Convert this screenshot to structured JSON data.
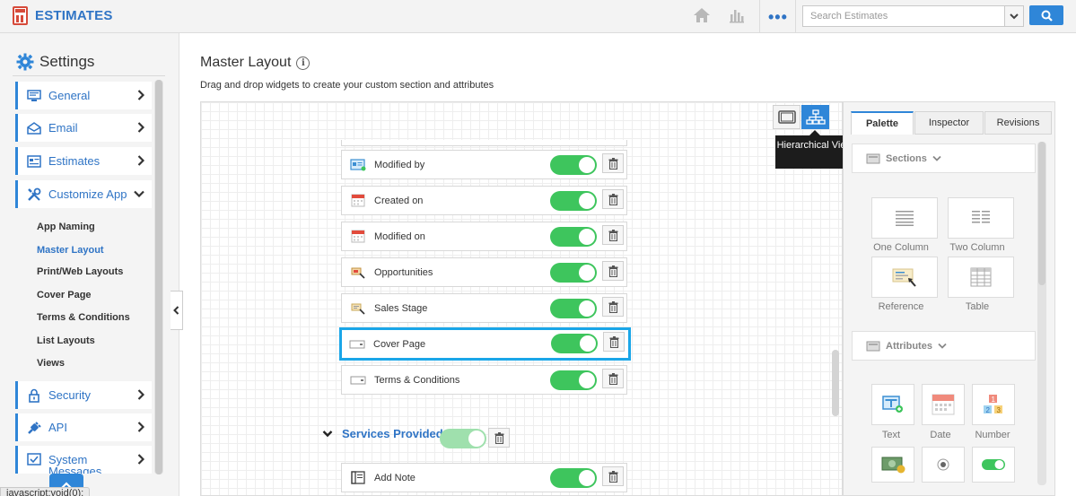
{
  "app": {
    "name": "ESTIMATES"
  },
  "search": {
    "placeholder": "Search Estimates"
  },
  "sidebar": {
    "title": "Settings",
    "items": [
      {
        "label": "General"
      },
      {
        "label": "Email"
      },
      {
        "label": "Estimates"
      },
      {
        "label": "Customize App"
      },
      {
        "label": "Security"
      },
      {
        "label": "API"
      },
      {
        "label": "System Messages"
      }
    ],
    "subitems": [
      {
        "label": "App Naming"
      },
      {
        "label": "Master Layout"
      },
      {
        "label": "Print/Web Layouts"
      },
      {
        "label": "Cover Page"
      },
      {
        "label": "Terms & Conditions"
      },
      {
        "label": "List Layouts"
      },
      {
        "label": "Views"
      }
    ]
  },
  "status_tip": "javascript:void(0);",
  "main": {
    "title": "Master Layout",
    "description": "Drag and drop widgets to create your custom section and attributes",
    "tooltip": "Hierarchical View",
    "rows": [
      {
        "label": "Modified by",
        "icon": "user-card-icon"
      },
      {
        "label": "Created on",
        "icon": "calendar-icon"
      },
      {
        "label": "Modified on",
        "icon": "calendar-icon"
      },
      {
        "label": "Opportunities",
        "icon": "opportunity-icon"
      },
      {
        "label": "Sales Stage",
        "icon": "reference-icon"
      },
      {
        "label": "Cover Page",
        "icon": "text-field-icon"
      },
      {
        "label": "Terms & Conditions",
        "icon": "text-field-icon"
      }
    ],
    "section": {
      "title": "Services Provided"
    },
    "section_rows": [
      {
        "label": "Add Note",
        "icon": "note-icon"
      }
    ]
  },
  "panel": {
    "tabs": [
      "Palette",
      "Inspector",
      "Revisions"
    ],
    "sections_label": "Sections",
    "attributes_label": "Attributes",
    "section_widgets": [
      "One Column",
      "Two Column",
      "Reference",
      "Table"
    ],
    "attribute_widgets": [
      "Text",
      "Date",
      "Number"
    ]
  },
  "colors": {
    "accent": "#2f86d8",
    "brand": "#2f74c5",
    "toggle_on": "#3ec55d",
    "highlight": "#1aa6e8"
  }
}
